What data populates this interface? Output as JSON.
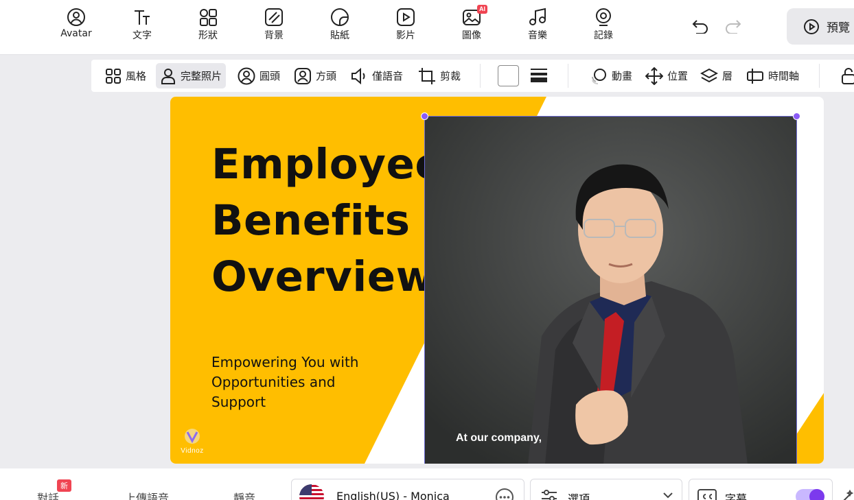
{
  "top_toolbar": {
    "tools": [
      {
        "label": "Avatar",
        "icon": "avatar-icon"
      },
      {
        "label": "文字",
        "icon": "text-icon"
      },
      {
        "label": "形狀",
        "icon": "shapes-icon"
      },
      {
        "label": "背景",
        "icon": "background-icon"
      },
      {
        "label": "貼紙",
        "icon": "sticker-icon"
      },
      {
        "label": "影片",
        "icon": "video-icon"
      },
      {
        "label": "圖像",
        "icon": "image-icon",
        "badge": "AI"
      },
      {
        "label": "音樂",
        "icon": "music-icon"
      },
      {
        "label": "記錄",
        "icon": "record-icon"
      }
    ],
    "undo_icon": "undo-icon",
    "redo_icon": "redo-icon",
    "preview_label": "預覽"
  },
  "sub_toolbar": {
    "items": [
      {
        "label": "風格",
        "icon": "style-grid-icon"
      },
      {
        "label": "完整照片",
        "icon": "full-photo-icon",
        "active": true
      },
      {
        "label": "圓頭",
        "icon": "round-head-icon"
      },
      {
        "label": "方頭",
        "icon": "square-head-icon"
      },
      {
        "label": "僅語音",
        "icon": "voice-only-icon"
      },
      {
        "label": "剪裁",
        "icon": "crop-icon"
      }
    ],
    "color_value": "#ffffff",
    "stroke_icon": "stroke-lines-icon",
    "right_items": [
      {
        "label": "動畫",
        "icon": "animation-icon"
      },
      {
        "label": "位置",
        "icon": "position-icon"
      },
      {
        "label": "層",
        "icon": "layers-icon"
      },
      {
        "label": "時間軸",
        "icon": "timeline-icon"
      }
    ],
    "lock_icon": "unlock-icon"
  },
  "slide": {
    "title": "Employee\nBenefits\nOverview",
    "subtitle": "Empowering You with Opportunities and Support",
    "logo_text": "Vidnoz",
    "caption": "At our company,",
    "accent_color": "#ffbe00",
    "photo_bg": "#3c3e3d"
  },
  "bottom_bar": {
    "tabs": [
      "對話",
      "上傳語音",
      "靜音"
    ],
    "new_badge": "新",
    "voice": "English(US) - Monica",
    "options_label": "選項",
    "subtitles_label": "字幕",
    "subtitles_on": true
  }
}
